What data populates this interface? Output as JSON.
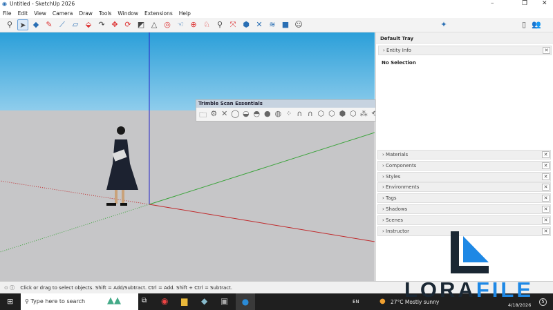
{
  "window": {
    "title": "Untitled - SketchUp 2026",
    "minimize": "–",
    "restore": "❐",
    "close": "✕"
  },
  "menu": [
    "File",
    "Edit",
    "View",
    "Camera",
    "Draw",
    "Tools",
    "Window",
    "Extensions",
    "Help"
  ],
  "toolbar_icons": [
    "search-icon",
    "select-icon",
    "eraser-icon",
    "pencil-icon",
    "line-icon",
    "rectangle-icon",
    "push-pull-icon",
    "follow-me-icon",
    "move-icon",
    "rotate-icon",
    "scale-icon",
    "tape-icon",
    "orbit-icon",
    "pan-icon",
    "section-icon",
    "walk-icon",
    "zoom-icon",
    "zoom-extents-icon",
    "warehouse-icon",
    "extension-icon",
    "layers-icon",
    "chat-icon",
    "account-icon"
  ],
  "tray": {
    "title": "Default Tray",
    "entity_info": "Entity Info",
    "selection": "No Selection",
    "panels": [
      "Materials",
      "Components",
      "Styles",
      "Environments",
      "Tags",
      "Shadows",
      "Scenes",
      "Instructor"
    ],
    "close": "✕",
    "chevron": "›"
  },
  "scan_toolbar": {
    "title": "Trimble Scan Essentials",
    "close": "✕"
  },
  "status": {
    "text": "Click or drag to select objects. Shift = Add/Subtract. Ctrl = Add. Shift + Ctrl = Subtract."
  },
  "taskbar": {
    "search_placeholder": "Type here to search",
    "language": "EN",
    "weather": "27°C  Mostly sunny",
    "date": "4/18/2026",
    "notifications": "5"
  },
  "watermark": {
    "text_dark": "LORA",
    "text_blue": "FILE",
    "color_dark": "#1a2733",
    "color_blue": "#1e88e5"
  },
  "colors": {
    "sky": "#2b9fd9",
    "ground": "#c6c6c8",
    "axis_red": "#c0282a",
    "axis_green": "#3aa33a",
    "axis_blue": "#2323c8"
  }
}
